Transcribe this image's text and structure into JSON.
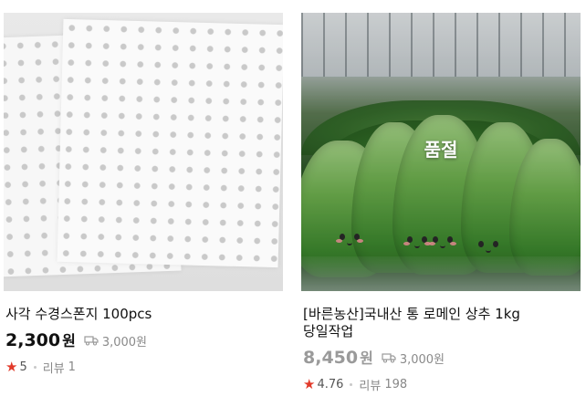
{
  "products": [
    {
      "title": "사각 수경스폰지 100pcs",
      "price": "2,300",
      "currency": "원",
      "shipping": "3,000원",
      "rating": "5",
      "review_label": "리뷰",
      "review_count": "1",
      "sold_out": false
    },
    {
      "title_line1": "[바른농산]국내산 통 로메인 상추 1kg",
      "title_line2": "당일작업",
      "price": "8,450",
      "currency": "원",
      "shipping": "3,000원",
      "rating": "4.76",
      "review_label": "리뷰",
      "review_count": "198",
      "sold_out": true,
      "sold_out_label": "품절"
    }
  ],
  "colors": {
    "star": "#e23a2a",
    "soldout_price": "#9a9a9a",
    "muted_text": "#8a8a8a"
  },
  "icons": {
    "shipping": "truck-icon",
    "rating": "star-icon"
  }
}
